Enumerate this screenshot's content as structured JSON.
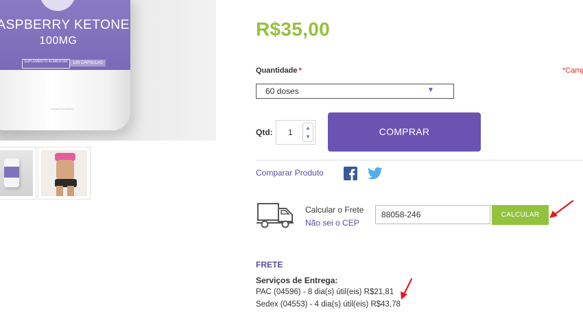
{
  "product_image": {
    "bottle_name": "RASPBERRY KETONE",
    "bottle_dose": "100MG",
    "bottle_sublabel": "SUPLEMENTO ALIMENTAR",
    "bottle_capsules": "120 CÁPSULAS",
    "bottle_fine_print": "Imagem ilustrativa"
  },
  "thumbnails": [
    {
      "name": "bottle-thumbnail"
    },
    {
      "name": "model-thumbnail"
    }
  ],
  "product": {
    "price": "R$35,00",
    "quantity_label": "Quantidade",
    "required_star": "*",
    "required_note": "*Camp",
    "selected_option": "60 doses",
    "qty_label": "Qtd:",
    "qty_value": "1",
    "buy_label": "COMPRAR"
  },
  "social": {
    "compare_label": "Comparar Produto",
    "facebook_icon": "f",
    "twitter_icon": "twitter-bird"
  },
  "shipping_calc": {
    "label": "Calcular o Frete",
    "help_link": "Não sei o CEP",
    "cep_value": "88058-246",
    "button_label": "CALCULAR"
  },
  "frete": {
    "title": "FRETE",
    "services_title": "Serviços de Entrega:",
    "services": [
      "PAC (04596) - 8 dia(s) útil(eis) R$21,81",
      "Sedex (04553) - 4 dia(s) útil(eis) R$43,78"
    ]
  },
  "colors": {
    "brand_purple": "#6a53b1",
    "price_green": "#94c23d",
    "link_purple": "#5b4b9e",
    "required_red": "#e3262d",
    "annotation_red": "#e8171f"
  }
}
